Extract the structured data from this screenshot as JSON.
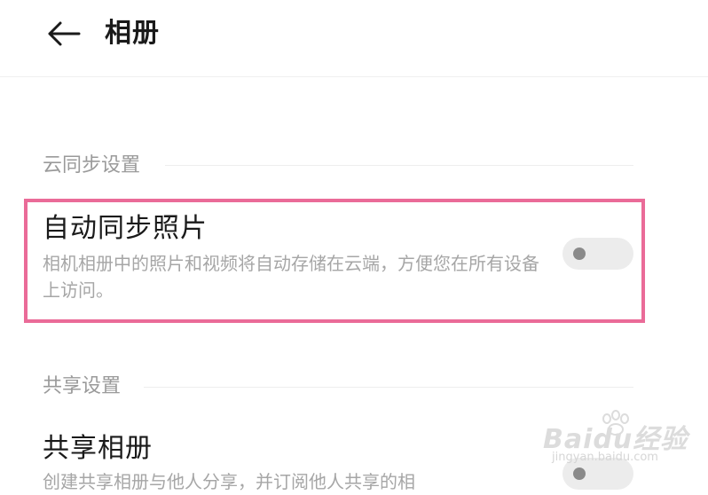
{
  "header": {
    "back_icon": "arrow-left-icon",
    "title": "相册"
  },
  "sections": [
    {
      "label": "云同步设置",
      "rows": [
        {
          "title": "自动同步照片",
          "description": "相机相册中的照片和视频将自动存储在云端，方便您在所有设备上访问。",
          "toggle_on": false
        }
      ]
    },
    {
      "label": "共享设置",
      "rows": [
        {
          "title": "共享相册",
          "description": "创建共享相册与他人分享，并订阅他人共享的相",
          "toggle_on": false
        }
      ]
    }
  ],
  "colors": {
    "highlight": "#ea6b98",
    "toggle_track": "#ececec",
    "toggle_knob": "#8a8a8a",
    "secondary_text": "#a6a6a6"
  },
  "watermark": {
    "main": "Baidu经验",
    "sub": "jingyan.baidu.com"
  }
}
